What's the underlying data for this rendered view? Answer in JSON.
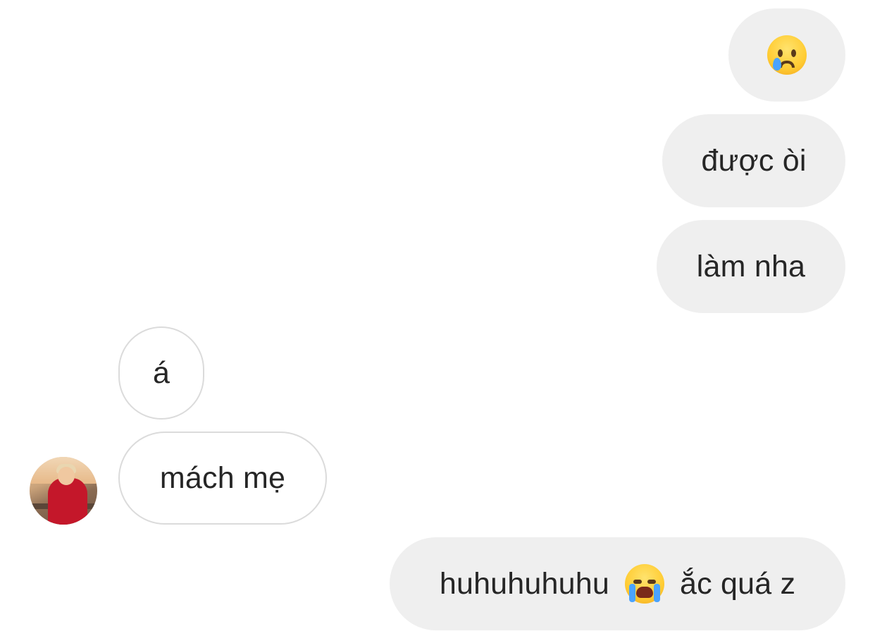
{
  "messages": [
    {
      "id": "m1",
      "side": "sent",
      "emoji": "crying-face"
    },
    {
      "id": "m2",
      "side": "sent",
      "text": "được òi"
    },
    {
      "id": "m3",
      "side": "sent",
      "text": "làm nha"
    },
    {
      "id": "m4",
      "side": "received",
      "text": "á"
    },
    {
      "id": "m5",
      "side": "received",
      "text": "mách mẹ"
    },
    {
      "id": "m6",
      "side": "sent",
      "text_before": "huhuhuhuhu",
      "emoji": "loudly-crying-face",
      "text_after": "ắc quá z"
    }
  ],
  "colors": {
    "sent_bubble": "#efefef",
    "received_border": "#dbdbdb",
    "text": "#262626"
  }
}
